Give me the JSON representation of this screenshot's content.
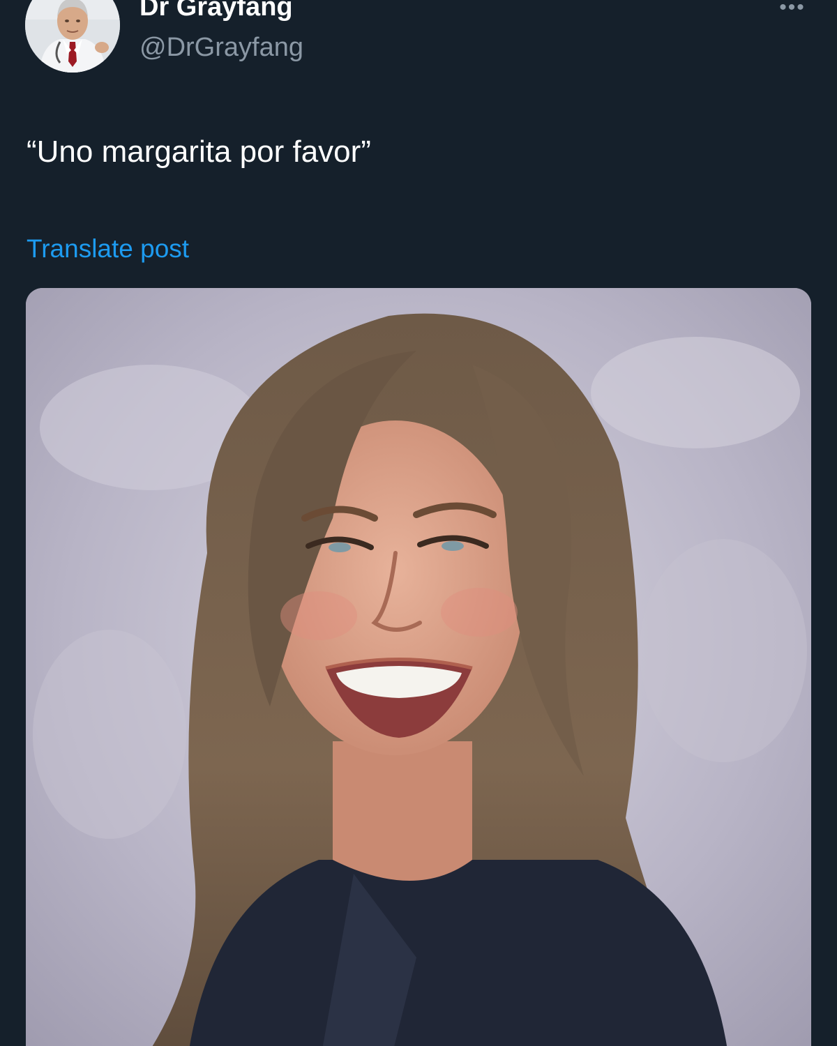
{
  "author": {
    "display_name": "Dr Grayfang",
    "handle": "@DrGrayfang",
    "avatar_icon": "doctor-avatar-icon"
  },
  "menu": {
    "more_icon": "ellipsis-icon",
    "more_glyph": "•••"
  },
  "post": {
    "text": "“Uno margarita por favor”",
    "translate_label": "Translate post"
  },
  "media": {
    "description_icon": "photo-icon"
  },
  "colors": {
    "background": "#15202b",
    "text_primary": "#ffffff",
    "text_secondary": "#8b98a5",
    "link": "#1d9bf0"
  }
}
